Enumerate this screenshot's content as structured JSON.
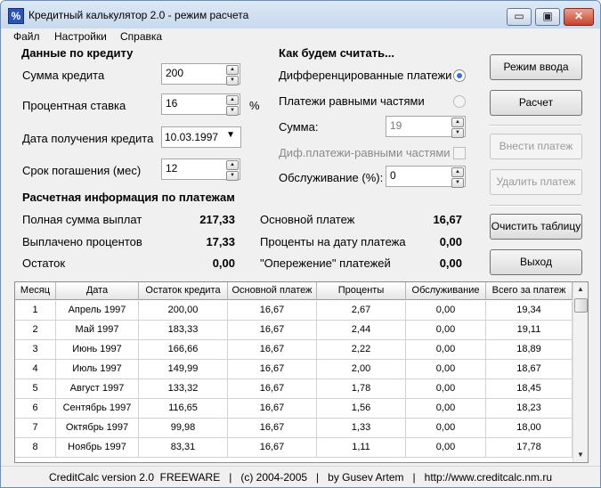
{
  "window": {
    "icon_glyph": "%",
    "title": "Кредитный калькулятор 2.0 - режим расчета",
    "controls": {
      "minimize": "▭",
      "maximize": "▣",
      "close": "✕"
    }
  },
  "menu": [
    "Файл",
    "Настройки",
    "Справка"
  ],
  "credit": {
    "title": "Данные по кредиту",
    "amount_label": "Сумма кредита",
    "amount": "200",
    "rate_label": "Процентная ставка",
    "rate": "16",
    "rate_unit": "%",
    "date_label": "Дата получения кредита",
    "date": "10.03.1997",
    "term_label": "Срок погашения (мес)",
    "term": "12"
  },
  "calc": {
    "title": "Как будем считать...",
    "differentiated": "Дифференцированные платежи",
    "annuity": "Платежи равными частями",
    "sum_label": "Сумма:",
    "sum": "19",
    "mixed_label": "Диф.платежи-равными частями",
    "service_label": "Обслуживание (%):",
    "service": "0",
    "selected_mode": "differentiated"
  },
  "buttons": {
    "input_mode": "Режим ввода",
    "calculate": "Расчет",
    "add_payment": "Внести платеж",
    "delete_payment": "Удалить платеж",
    "clear_table": "Очистить таблицу",
    "exit": "Выход"
  },
  "info": {
    "title": "Расчетная информация по платежам",
    "total_label": "Полная сумма выплат",
    "total": "217,33",
    "interest_paid_label": "Выплачено процентов",
    "interest_paid": "17,33",
    "remainder_label": "Остаток",
    "remainder": "0,00",
    "principal_label": "Основной платеж",
    "principal": "16,67",
    "interest_date_label": "Проценты на дату платежа",
    "interest_date": "0,00",
    "advance_label": "\"Опережение\" платежей",
    "advance": "0,00"
  },
  "table": {
    "headers": [
      "Месяц",
      "Дата",
      "Остаток кредита",
      "Основной платеж",
      "Проценты",
      "Обслуживание",
      "Всего за платеж"
    ],
    "rows": [
      [
        "1",
        "Апрель 1997",
        "200,00",
        "16,67",
        "2,67",
        "0,00",
        "19,34"
      ],
      [
        "2",
        "Май 1997",
        "183,33",
        "16,67",
        "2,44",
        "0,00",
        "19,11"
      ],
      [
        "3",
        "Июнь 1997",
        "166,66",
        "16,67",
        "2,22",
        "0,00",
        "18,89"
      ],
      [
        "4",
        "Июль 1997",
        "149,99",
        "16,67",
        "2,00",
        "0,00",
        "18,67"
      ],
      [
        "5",
        "Август 1997",
        "133,32",
        "16,67",
        "1,78",
        "0,00",
        "18,45"
      ],
      [
        "6",
        "Сентябрь 1997",
        "116,65",
        "16,67",
        "1,56",
        "0,00",
        "18,23"
      ],
      [
        "7",
        "Октябрь 1997",
        "99,98",
        "16,67",
        "1,33",
        "0,00",
        "18,00"
      ],
      [
        "8",
        "Ноябрь 1997",
        "83,31",
        "16,67",
        "1,11",
        "0,00",
        "17,78"
      ]
    ]
  },
  "status": "CreditCalc version 2.0  FREEWARE   |   (c) 2004-2005   |   by Gusev Artem   |   http://www.creditcalc.nm.ru",
  "colors": {
    "titlebar": "#c7d9ee",
    "close_button": "#c4442e",
    "radio_selected": "#3b6fd1"
  }
}
